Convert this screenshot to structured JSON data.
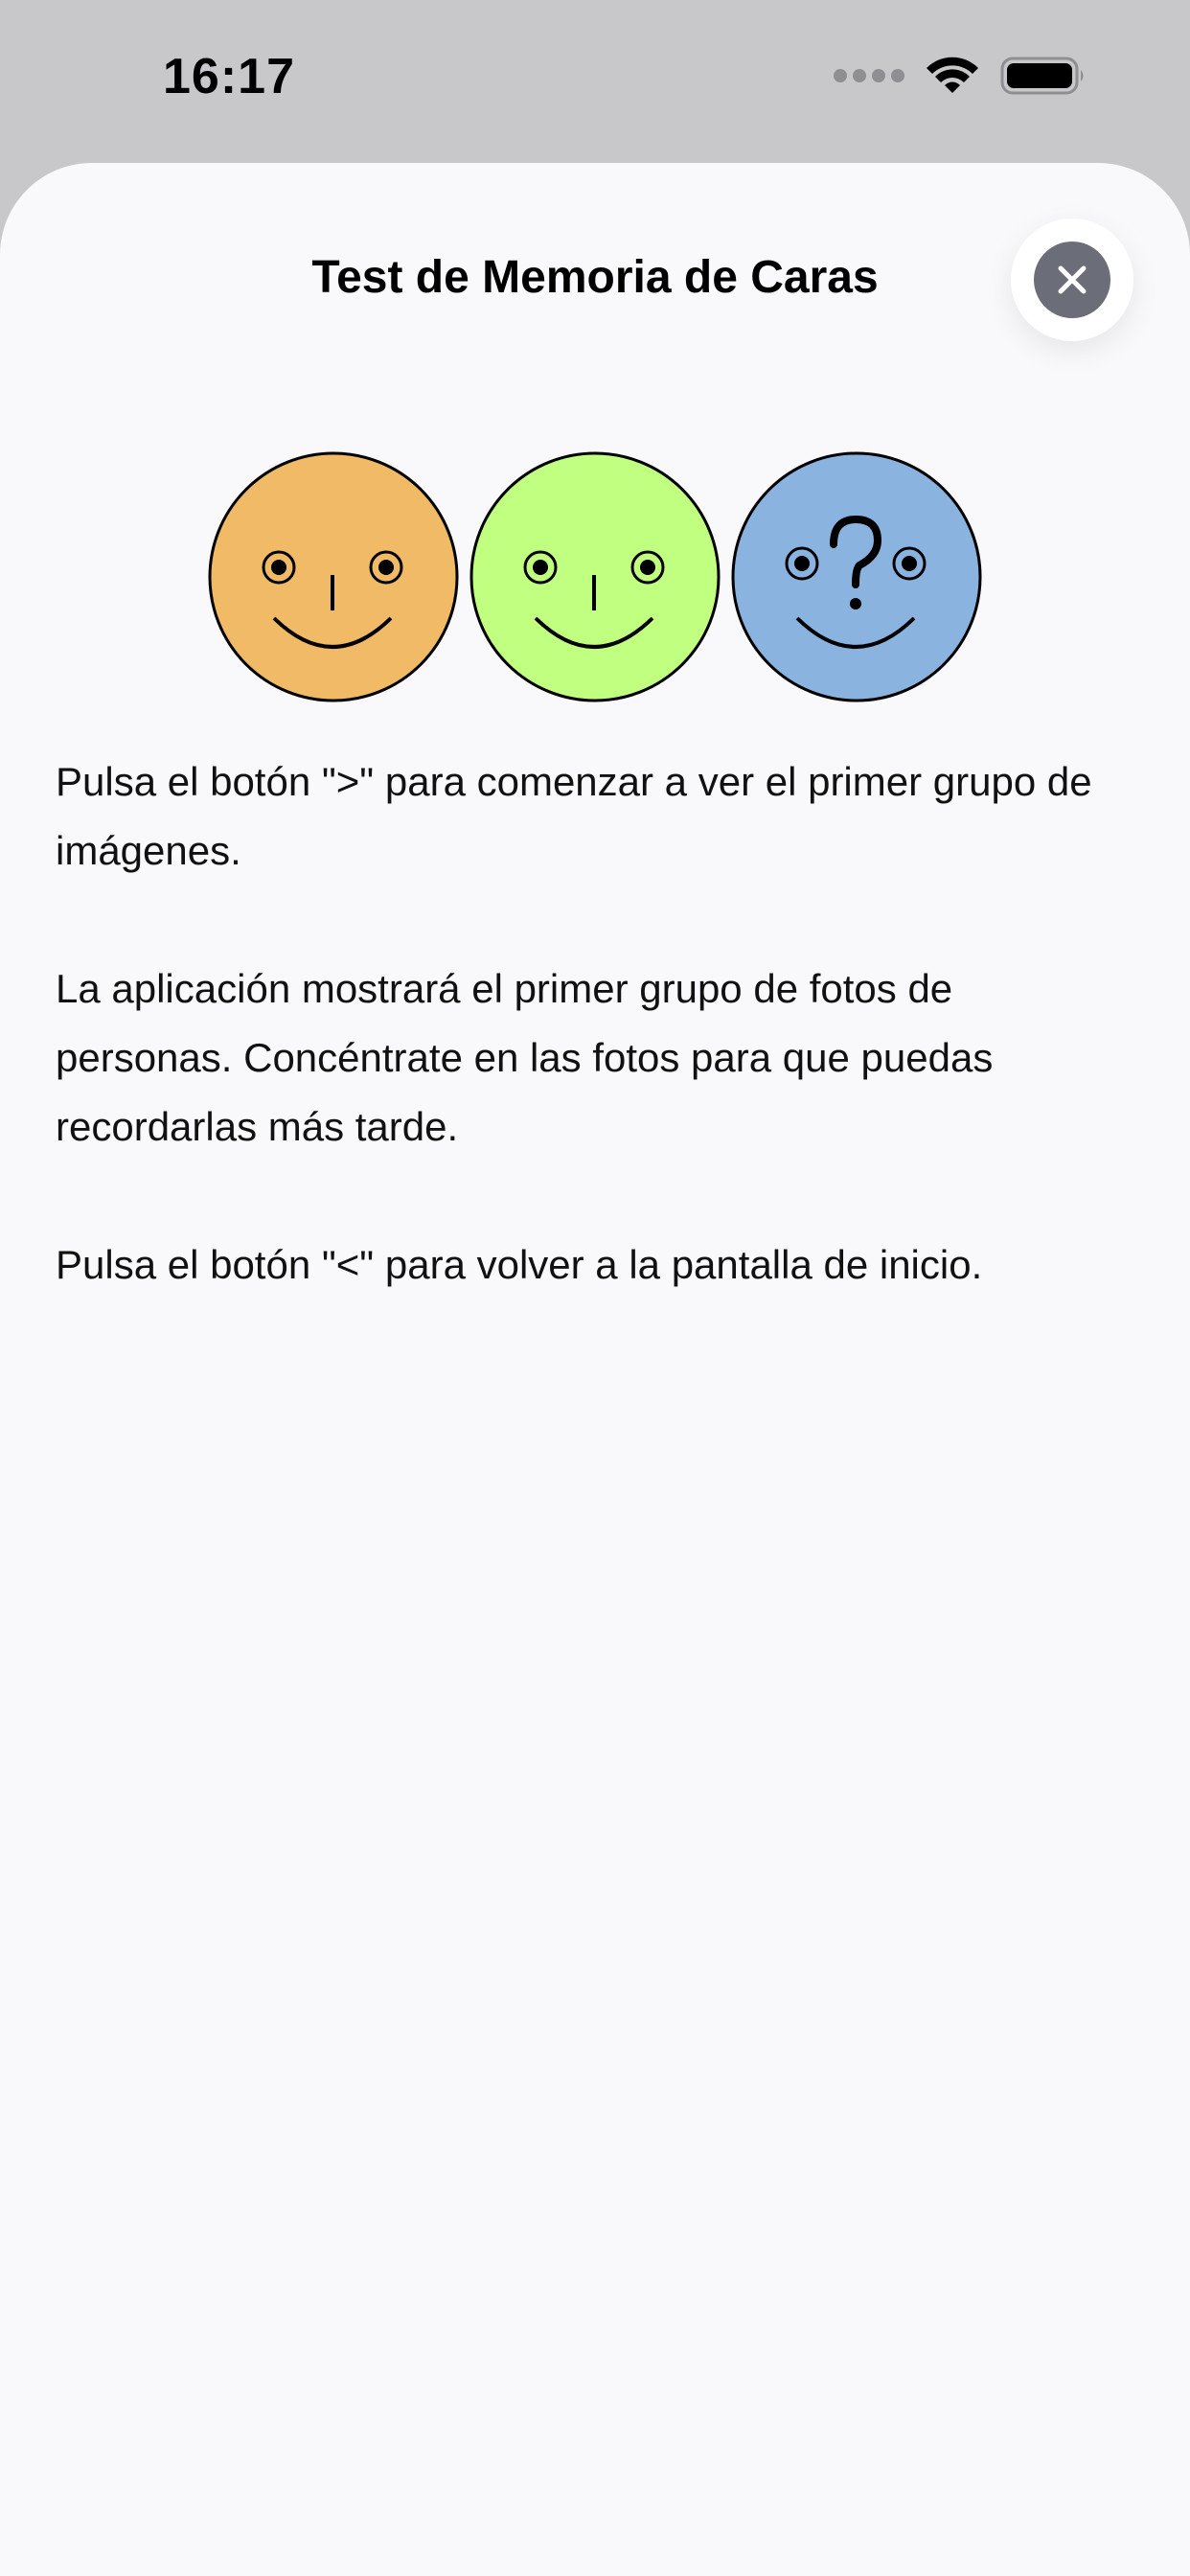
{
  "status_bar": {
    "time": "16:17",
    "icons": [
      "signal-icon",
      "wifi-icon",
      "battery-icon"
    ]
  },
  "sheet": {
    "title": "Test de Memoria de Caras",
    "close_icon": "close-icon"
  },
  "faces": [
    {
      "name": "orange-face",
      "color": "#f0ba66"
    },
    {
      "name": "green-face",
      "color": "#c1ff80"
    },
    {
      "name": "blue-face",
      "color": "#8ab3e0"
    }
  ],
  "instructions": [
    "Pulsa el botón \">\" para comenzar a ver el primer grupo de imágenes.",
    "La aplicación mostrará el primer grupo de fotos de personas. Concéntrate en las fotos para que puedas recordarlas más tarde.",
    "Pulsa el botón \"<\" para volver a la pantalla de inicio."
  ],
  "colors": {
    "sheet_bg": "#f9f9fb",
    "status_bg": "#c8c8ca",
    "close_bg": "#6b6e78"
  }
}
